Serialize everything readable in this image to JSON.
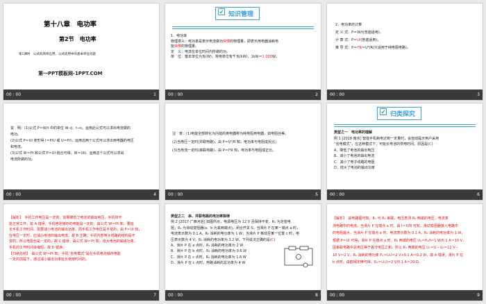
{
  "time": "00 : 00",
  "slides": [
    {
      "num": "1",
      "chapter": "第十八章　电功率",
      "section": "第2节　电功率",
      "sub": "第1课时　公式的简单应用、公式适用中的基本单位问题",
      "brand": "第一PPT模板网-1PPT.COM"
    },
    {
      "num": "2",
      "heading": "知识管理",
      "l1": "1．电功率",
      "l2a": "物理意义：电功率是表示电流做功",
      "l2b": "快慢",
      "l2c": "的物理量，即表示用电器消耗电",
      "l3a": "能",
      "l3b": "快慢",
      "l3c": "的物理量。",
      "l4": "定　义：电流在单位时间内所做的功。",
      "l5a": "单　位：基本单位为瓦(W)，常用单位有千瓦(kW)，1kW＝",
      "l5b": "1 000",
      "l5c": "W。"
    },
    {
      "num": "3",
      "l1": "2．电功率的计算",
      "l2": "定 义 式：P＝W/t(普遍适用)。",
      "l3a": "计 算 式：P＝",
      "l3b": "UI",
      "l3c": "(普遍适用)。",
      "l4a": "推 导 式：P＝",
      "l4b": "I²R",
      "l4c": "＝U²/R(只适用于纯电阻电路)。"
    },
    {
      "num": "4",
      "l1": "说　明：(1)公式 P＝W/t 中的单位 W→J、t→s，运用此公式可以求出电流做的",
      "l2": "电功。",
      "l3": "(2)公式 P＝UI 变形得 I＝P/U 或 U＝P/I，运用这两个公式可以求出用电器的电压",
      "l4": "和电流。",
      "l5": "(3)公式 W＝Pt 和公式 P＝UI 结合可得，W＝UIt。运用这个公式可以求出",
      "l6": "电流所做的功。"
    },
    {
      "num": "5",
      "l1": "注　意：(1)电能全部转化为内能的用电器称为纯电阻用电器，如电阻丝等。",
      "l2": "(2)当电压一定时(并联电路)，由 P＝U²/R 知，电功率与电阻成反比；",
      "l3": "(3)当电流一定时(串联电路)，由 P＝I²R 知，电功率与电阻成正比。"
    },
    {
      "num": "6",
      "heading": "归类探究",
      "type": "类型之一　电功率的理解",
      "q1": "例 1 [2018·南京] 智能手机耗电达到一定量时，会自动提示用户采用",
      "q2a": "“省电模式”，在这种模式下，可延长电池的供电时间，原因是(",
      "q2b": "C",
      "q2c": ")",
      "opts": [
        "A．降低了电池的输出电压",
        "B．减小了电池的输出电流",
        "C．减小了电子线路的电阻",
        "D．增大了电池的输出功率"
      ]
    },
    {
      "num": "7",
      "lines": [
        "【解析】　手机工作电压是一定的，如果降低了电池的输出电压，手机将不",
        "能正常工作，故 A 错误；手机电池储存的电能是一定的，由公式 W＝Pt 知，要延",
        "长手机工作时间，需要减小电池的输出功率，而手机工作电压是不变的，由 P＝UI 知，",
        "在电压一定时，应减小电池的输出电流，故 B 正确；手机内部电子线路的结构是不",
        "变的，所以电阻也是一定的，故 C 错误；由公式 W＝Pt 知，增大电池的输出功率，",
        "手机的工作时间会缩短，故 D 错误。",
        "【归纳总结】　由公式 W＝Pt 知，手机“省电模式”是在手机电池储存电能",
        "一定的前提下，通过减小输出功率延长使用时间的。"
      ]
    },
    {
      "num": "8",
      "type": "类型之二　串、并联电路的电功率规律",
      "q": [
        "例 2 [2017·广西河池] 如图所示，电源电压为 12 V 且保持不变，R₁ 为定值电",
        "阻，R₂ 为滑动变阻器(a、b 为其两端点)。闭合开关 S，当滑片 P 在某一端点 a 时，",
        "电流表示数为 0.1 A，R₂ 消耗的电功率为 1 W；当滑片 P 移动至某一位置 c 时，电",
        "压表示数为 4 V，R₁ 消耗的电功率为 3.2 W。下列说法正确的是("
      ],
      "ans": "C",
      "opts": [
        "A．滑片 P 在 a 点时，R₁ 消耗的电功率为 2 W",
        "B．滑片 P 在 b 点时，R₁ 消耗的电功率为 0.6 W",
        "C．滑片 P 在 c 点时，R₂ 消耗的电功率为 1.6 W",
        "D．滑片 P 在 c 点时，电路消耗的总功率为 4 W"
      ]
    },
    {
      "num": "9",
      "lines": [
        "【解析】　由电路图可知，R₁ 与 R₂ 串联，电压表测 R₂ 两端的电压，电流表",
        "测电路中的电流。当滑片 P 在端点 a 时，由 I＝U/R 可知，滑动变阻器接入电路中",
        "的电阻最大，当滑片 P 在端点 a 时，电流表示数为 0.1 A，R₂ 消耗的电功率为 1 W，",
        "根据 P＝UI 可得，滑片 P 在端点 a 时，R₂ 两端的电压 U₂＝P₂/I＝1 W/0.1 A＝10 V，",
        "因串联电路中总电压等于各分电压之和，所以 R₁ 两端的电压 U₁＝U－U₂＝12 V－",
        "10 V＝2 V，R₁ 消耗的电功率 P₁＝U₁I＝2 V×0.1 A＝0.2 W，故 A 错误；滑片 P 在",
        "b 点时，由欧姆定律可得，R₁＝U₁/I＝2 V/0.1 A＝20 Ω。"
      ]
    }
  ]
}
